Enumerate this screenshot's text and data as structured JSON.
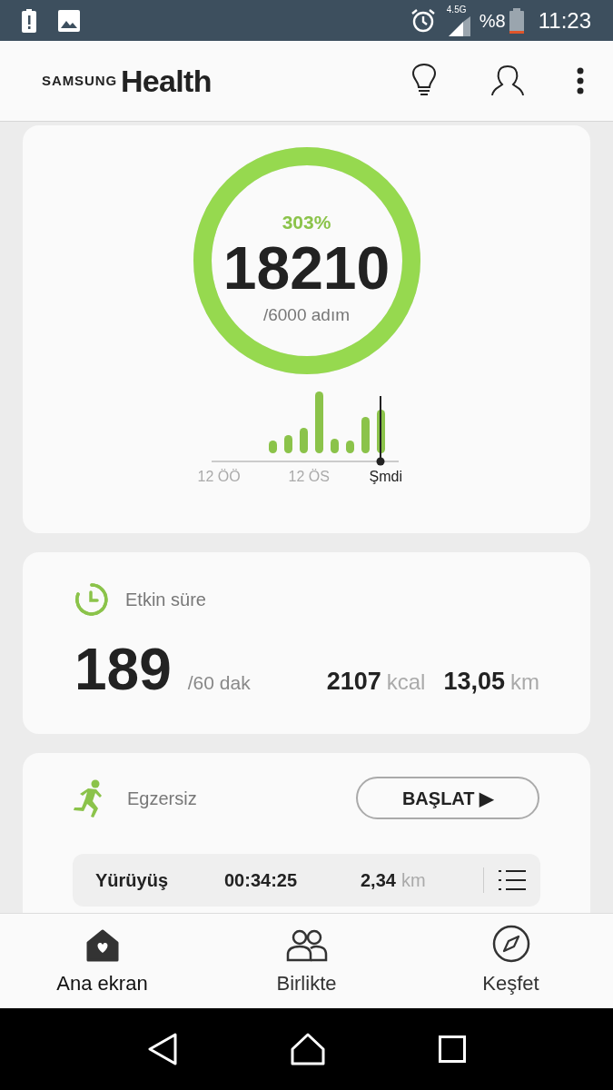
{
  "status_bar": {
    "battery": "%8",
    "time": "11:23",
    "network": "4.5G"
  },
  "header": {
    "brand": "SAMSUNG",
    "title": "Health"
  },
  "steps_card": {
    "percent": "303%",
    "count": "18210",
    "goal": "/6000 adım",
    "chart_labels": [
      "12 ÖÖ",
      "12 ÖS",
      "Şmdi"
    ]
  },
  "active_card": {
    "title": "Etkin süre",
    "minutes": "189",
    "goal": "/60 dak",
    "calories": "2107",
    "calories_unit": "kcal",
    "distance": "13,05",
    "distance_unit": "km"
  },
  "exercise_card": {
    "title": "Egzersiz",
    "start_button": "BAŞLAT ▶",
    "workout": {
      "name": "Yürüyüş",
      "duration": "00:34:25",
      "distance": "2,34",
      "unit": "km"
    }
  },
  "bottom_nav": [
    {
      "label": "Ana ekran",
      "kind": "home",
      "selected": true
    },
    {
      "label": "Birlikte",
      "kind": "people",
      "selected": false
    },
    {
      "label": "Keşfet",
      "kind": "compass",
      "selected": false
    }
  ]
}
